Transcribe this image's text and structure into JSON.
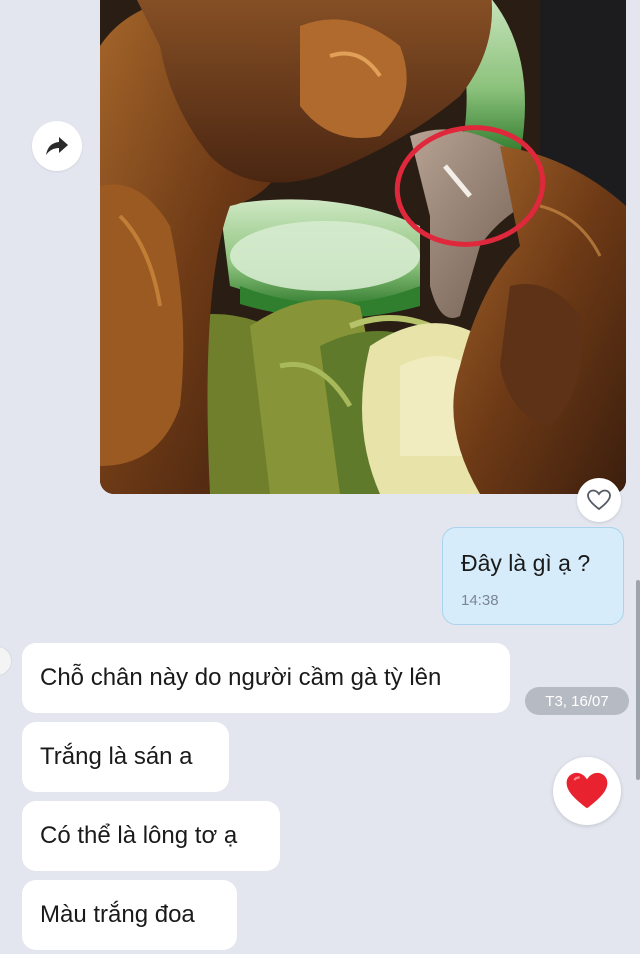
{
  "photo": {
    "icon": "chicken-photo",
    "annotation_color": "#e0283c"
  },
  "share_button": {
    "icon": "share-arrow-icon"
  },
  "photo_reaction": {
    "icon": "heart-outline-icon"
  },
  "sent_message": {
    "text": "Đây là gì ạ ?",
    "time": "14:38"
  },
  "received_messages": [
    {
      "text": "Chỗ chân này do người cầm gà tỳ lên"
    },
    {
      "text": "Trắng là sán a"
    },
    {
      "text": "Có thể là lông tơ ạ"
    },
    {
      "text": "Màu trắng đoa"
    }
  ],
  "date_chip": "T3, 16/07",
  "message_reaction": {
    "icon": "red-heart-icon",
    "color": "#e8232f"
  },
  "colors": {
    "background": "#e3e6ef",
    "sent_bubble": "#d6ecfa",
    "received_bubble": "#ffffff"
  }
}
